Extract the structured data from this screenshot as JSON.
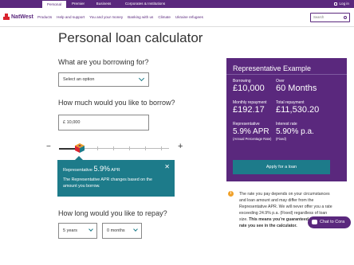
{
  "topnav": {
    "tabs": [
      "Personal",
      "Premier",
      "Business",
      "Corporates & Institutions"
    ],
    "login": "Log in"
  },
  "brand": "NatWest",
  "nav": {
    "links": [
      "Products",
      "Help and support",
      "You and your money",
      "Banking with us",
      "Climate",
      "Ukraine refugees"
    ],
    "search_placeholder": "Search"
  },
  "page": {
    "title": "Personal loan calculator",
    "borrowing_question": "What are you borrowing for?",
    "borrowing_select": "Select an option",
    "amount_question": "How much would you like to borrow?",
    "amount_value": "£ 10,000",
    "tooltip": {
      "prefix": "Representative",
      "rate": "5.9%",
      "suffix": "APR",
      "body": "The Representative APR changes based on the amount you borrow."
    },
    "repay_question": "How long would you like to repay?",
    "years_value": "5 years",
    "months_value": "0 months"
  },
  "example": {
    "title": "Representative Example",
    "borrowing_label": "Borrowing",
    "borrowing_value": "£10,000",
    "over_label": "Over",
    "over_value": "60 Months",
    "monthly_label": "Monthly repayment",
    "monthly_value": "£192.17",
    "total_label": "Total repayment",
    "total_value": "£11,530.20",
    "rep_label": "Representative",
    "rep_value": "5.9% APR",
    "rep_sub": "(Annual Percentage Rate)",
    "interest_label": "Interest rate",
    "interest_value": "5.90% p.a.",
    "interest_sub": "(Fixed)",
    "apply_label": "Apply for a loan"
  },
  "note": {
    "text": "The rate you pay depends on your circumstances and loan amount and may differ from the Representative APR. We will never offer you a rate exceeding 24.9% p.a. (Fixed) regardless of loan size.",
    "bold": "This means you're guaranteed to get the rate you see in the calculator."
  },
  "chat_label": "Chat to Cora",
  "slider": {
    "value_fraction": 0.12
  }
}
